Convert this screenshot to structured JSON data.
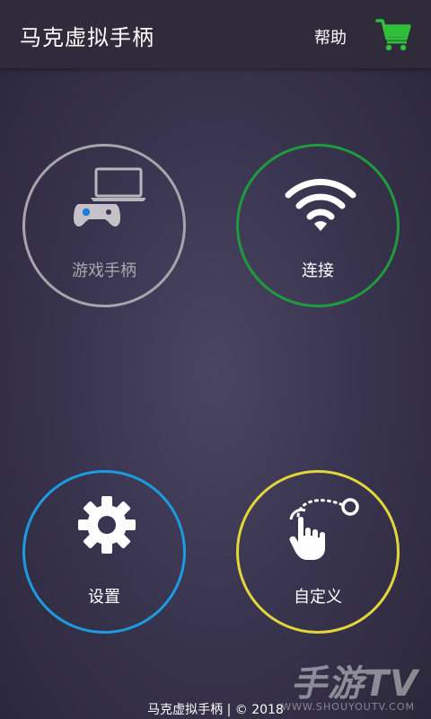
{
  "appbar": {
    "title": "马克虚拟手柄",
    "help_label": "帮助",
    "cart_icon": "shopping-cart-icon",
    "cart_color": "#2fbf3a"
  },
  "buttons": {
    "gamepad": {
      "label": "游戏手柄",
      "icon": "laptop-gamepad-icon",
      "ring_color": "#a7a5ab"
    },
    "connect": {
      "label": "连接",
      "icon": "wifi-icon",
      "ring_color": "#1e9b3e"
    },
    "settings": {
      "label": "设置",
      "icon": "gear-icon",
      "ring_color": "#1d9be0"
    },
    "custom": {
      "label": "自定义",
      "icon": "touch-gesture-icon",
      "ring_color": "#e2d63a"
    }
  },
  "footer": {
    "text": "马克虚拟手柄 | © 2018"
  },
  "watermark": {
    "big": "手游TV",
    "small": "WWW.SHOUYOUTV.COM"
  }
}
